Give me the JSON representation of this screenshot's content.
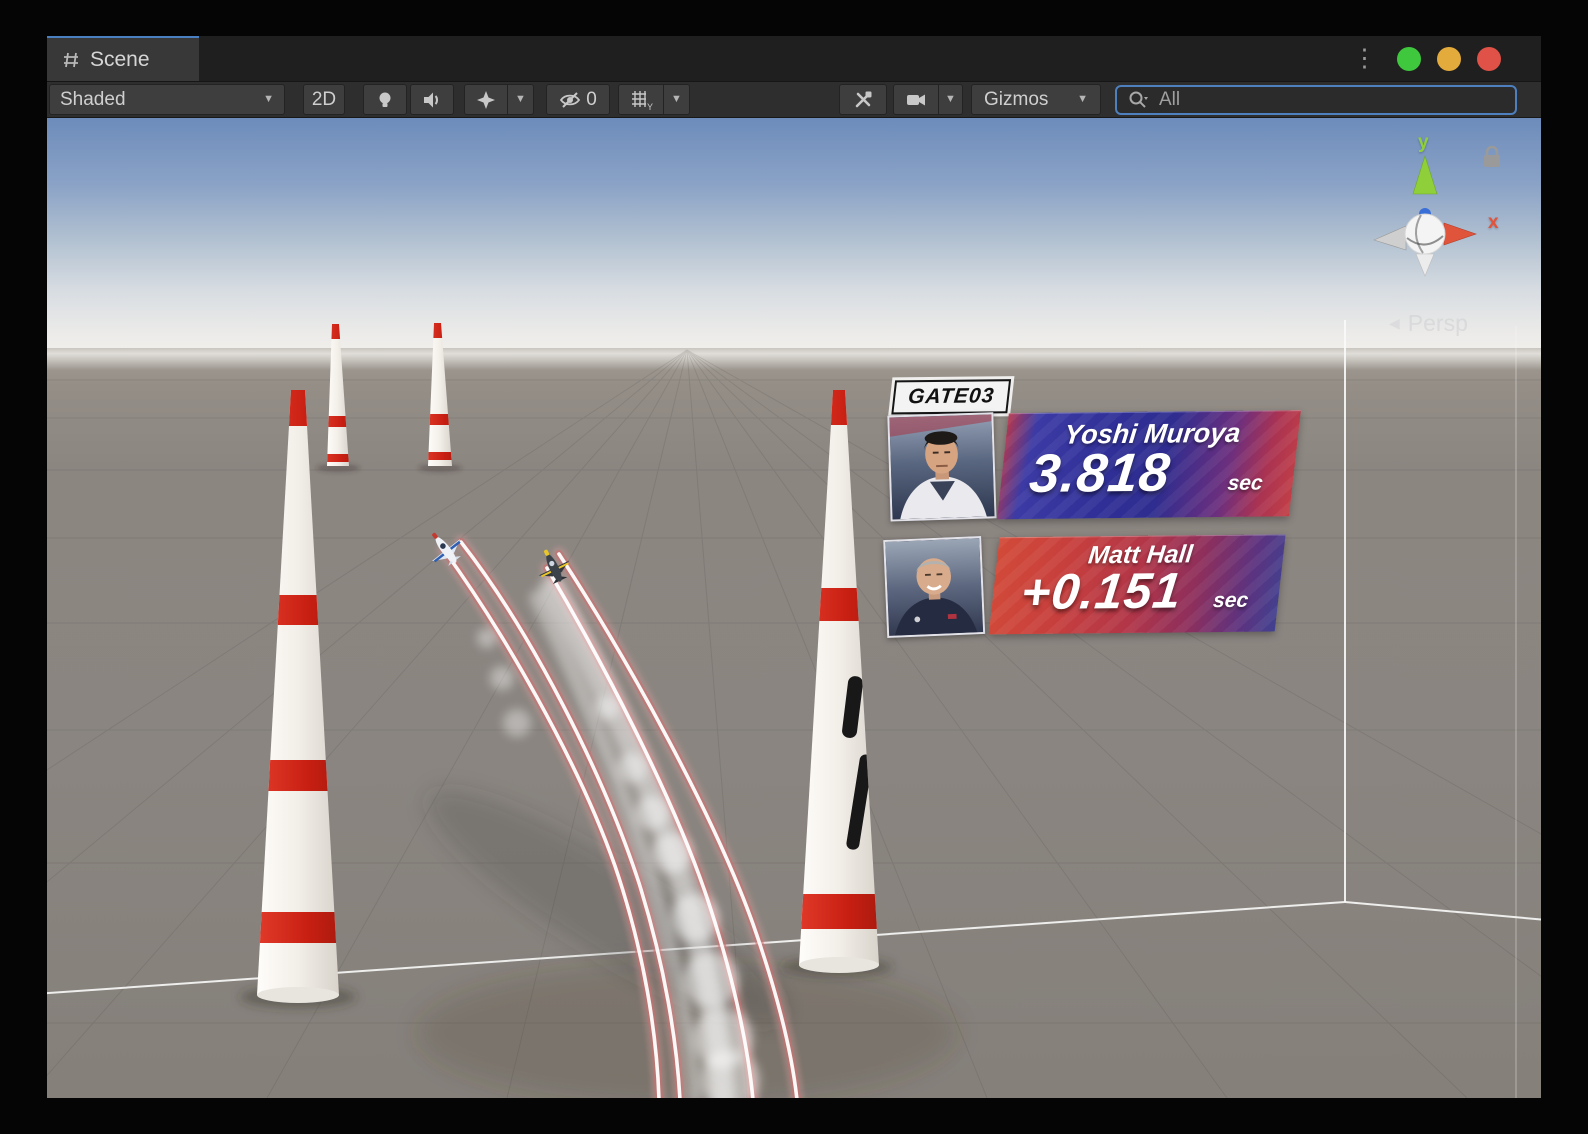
{
  "window": {
    "tab_label": "Scene"
  },
  "toolbar": {
    "shaded_label": "Shaded",
    "mode_2d_label": "2D",
    "hidden_count": "0",
    "grid_axis_label": "Y",
    "gizmos_label": "Gizmos",
    "search_value": "All"
  },
  "viewport": {
    "gizmo": {
      "x_label": "x",
      "y_label": "y",
      "persp_label": "Persp"
    },
    "race_ui": {
      "gate_label": "GATE03",
      "pilots": [
        {
          "name": "Yoshi Muroya",
          "time": "3.818",
          "unit": "sec"
        },
        {
          "name": "Matt Hall",
          "time": "+0.151",
          "unit": "sec"
        }
      ]
    }
  },
  "colors": {
    "tab_accent": "#4a7fc1",
    "traffic_green": "#3fc73e",
    "traffic_yellow": "#e3aa3c",
    "traffic_red": "#e05147",
    "pylon_red": "#d5281c",
    "panel_blue": "#2f2f97",
    "panel_red": "#c73f3d",
    "axis_x_red": "#e0543c",
    "axis_y_green": "#8fd03a"
  }
}
